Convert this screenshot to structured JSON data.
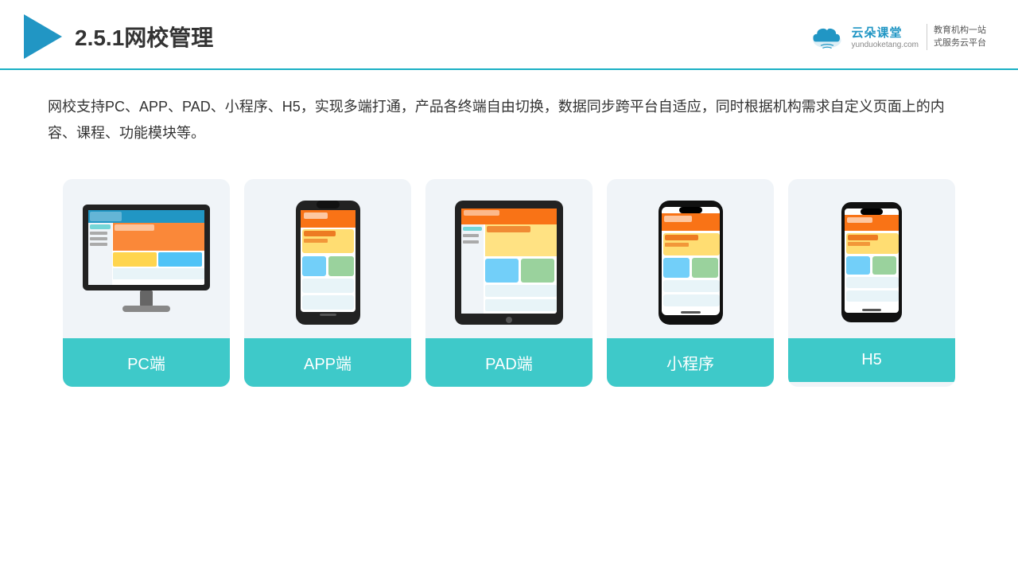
{
  "header": {
    "title": "2.5.1网校管理",
    "brand": {
      "name": "云朵课堂",
      "url": "yunduoketang.com",
      "slogan": "教育机构一站\n式服务云平台"
    }
  },
  "description": {
    "text": "网校支持PC、APP、PAD、小程序、H5，实现多端打通，产品各终端自由切换，数据同步跨平台自适应，同时根据机构需求自定义页面上的内容、课程、功能模块等。"
  },
  "cards": [
    {
      "id": "pc",
      "label": "PC端",
      "type": "pc"
    },
    {
      "id": "app",
      "label": "APP端",
      "type": "phone"
    },
    {
      "id": "pad",
      "label": "PAD端",
      "type": "tablet"
    },
    {
      "id": "miniprogram",
      "label": "小程序",
      "type": "phone"
    },
    {
      "id": "h5",
      "label": "H5",
      "type": "miniphone"
    }
  ],
  "colors": {
    "accent": "#3ec9c9",
    "header_border": "#1ab0c4",
    "brand_blue": "#2196c4",
    "card_bg": "#eef2f7"
  }
}
